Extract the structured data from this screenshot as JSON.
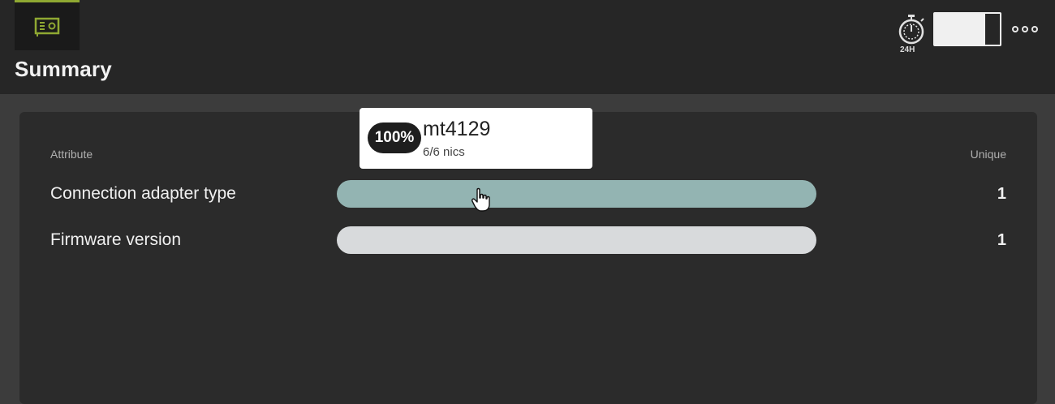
{
  "header": {
    "title": "Summary",
    "timer_label": "24H",
    "tab_icon": "network-card-icon"
  },
  "table": {
    "col_attribute": "Attribute",
    "col_unique": "Unique",
    "rows": [
      {
        "label": "Connection adapter type",
        "value": "1",
        "bar_color": "#93b4b2",
        "fill_fraction": 1.0
      },
      {
        "label": "Firmware version",
        "value": "1",
        "bar_color": "#d8dadc",
        "fill_fraction": 1.0
      }
    ]
  },
  "tooltip": {
    "percent": "100%",
    "name": "mt4129",
    "sub": "6/6 nics"
  },
  "colors": {
    "accent": "#8fa832",
    "header_bg": "#262626",
    "panel_bg": "#2b2b2b"
  }
}
